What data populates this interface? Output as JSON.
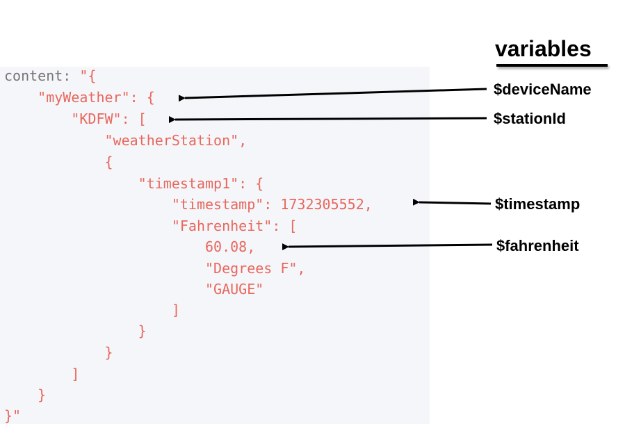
{
  "title": "variables",
  "code_lines": [
    {
      "label": "content: ",
      "text": "\"{"
    },
    {
      "label": "",
      "text": "    \"myWeather\": {"
    },
    {
      "label": "",
      "text": "        \"KDFW\": ["
    },
    {
      "label": "",
      "text": "            \"weatherStation\","
    },
    {
      "label": "",
      "text": "            {"
    },
    {
      "label": "",
      "text": "                \"timestamp1\": {"
    },
    {
      "label": "",
      "text": "                    \"timestamp\": 1732305552,"
    },
    {
      "label": "",
      "text": "                    \"Fahrenheit\": ["
    },
    {
      "label": "",
      "text": "                        60.08,"
    },
    {
      "label": "",
      "text": "                        \"Degrees F\","
    },
    {
      "label": "",
      "text": "                        \"GAUGE\""
    },
    {
      "label": "",
      "text": "                    ]"
    },
    {
      "label": "",
      "text": "                }"
    },
    {
      "label": "",
      "text": "            }"
    },
    {
      "label": "",
      "text": "        ]"
    },
    {
      "label": "",
      "text": "    }"
    },
    {
      "label": "",
      "text": "}\""
    }
  ],
  "variables": [
    {
      "name": "$deviceName"
    },
    {
      "name": "$stationId"
    },
    {
      "name": "$timestamp"
    },
    {
      "name": "$fahrenheit"
    }
  ],
  "colors": {
    "code_text": "#e8675c",
    "label_text": "#777777",
    "panel_bg": "#f5f6fa",
    "arrow": "#000000"
  }
}
